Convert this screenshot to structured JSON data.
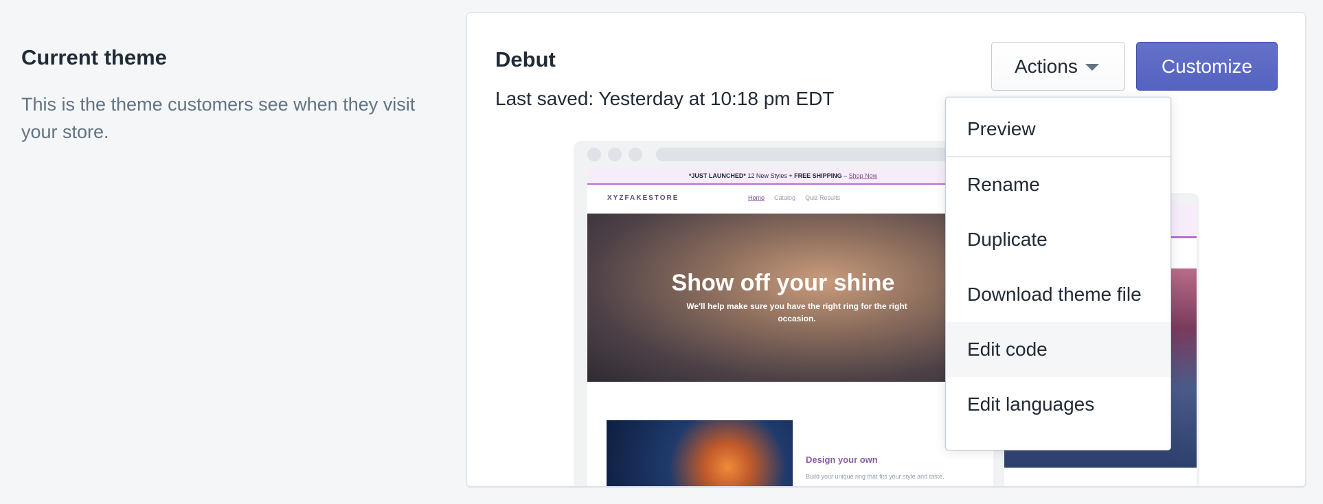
{
  "left": {
    "title": "Current theme",
    "description": "This is the theme customers see when they visit your store."
  },
  "card": {
    "title": "Debut",
    "last_saved": "Last saved: Yesterday at 10:18 pm EDT",
    "actions_label": "Actions",
    "customize_label": "Customize"
  },
  "preview": {
    "announcement_prefix": "*JUST LAUNCHED*",
    "announcement_mid": " 12 New Styles + ",
    "announcement_bold": "FREE SHIPPING",
    "announcement_sep": " – ",
    "announcement_link": "Shop Now",
    "logo": "XYZFAKESTORE",
    "nav": [
      "Home",
      "Catalog",
      "Quiz Results"
    ],
    "hero_title": "Show off your shine",
    "hero_subtitle": "We'll help make sure you have the right ring for the right occasion.",
    "section_title": "Design your own",
    "section_text": "Build your unique ring that fits your style and taste."
  },
  "dropdown": {
    "items": [
      "Preview",
      "Rename",
      "Duplicate",
      "Download theme file",
      "Edit code",
      "Edit languages"
    ],
    "hovered": "Edit code"
  },
  "colors": {
    "primary": "#5c6ac4",
    "background": "#f4f6f8",
    "text": "#212b36",
    "subdued": "#637381"
  }
}
